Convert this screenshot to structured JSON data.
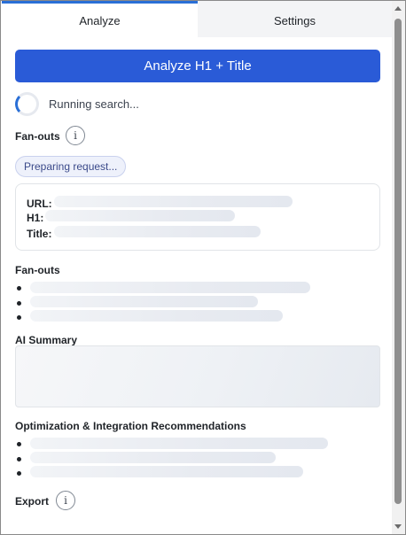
{
  "tabs": [
    {
      "label": "Analyze",
      "active": true
    },
    {
      "label": "Settings",
      "active": false
    }
  ],
  "actions": {
    "analyze_label": "Analyze H1 + Title"
  },
  "status": {
    "text": "Running search..."
  },
  "fanouts_header": {
    "label": "Fan-outs",
    "info_icon": "i"
  },
  "request_pill": {
    "label": "Preparing request..."
  },
  "page_info": {
    "url_label": "URL:",
    "h1_label": "H1:",
    "title_label": "Title:"
  },
  "fanouts_section": {
    "label": "Fan-outs",
    "placeholder_items": 3
  },
  "ai_summary": {
    "label": "AI Summary"
  },
  "recommendations": {
    "label": "Optimization & Integration Recommendations",
    "placeholder_items": 3
  },
  "export": {
    "label": "Export",
    "info_icon": "i"
  },
  "colors": {
    "accent": "#2a5bd7",
    "tab_indicator": "#2a6fd6",
    "skeleton": "#e8ebf1"
  }
}
